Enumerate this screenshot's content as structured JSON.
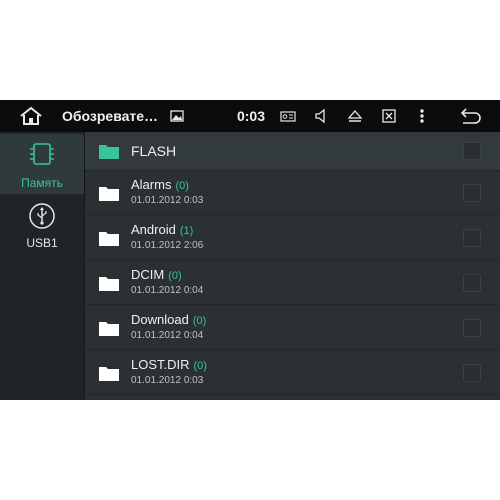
{
  "statusbar": {
    "title": "Обозревате…",
    "time": "0:03",
    "icons": [
      "home-icon",
      "gallery-icon",
      "radio-icon",
      "volume-icon",
      "eject-icon",
      "close-window-icon",
      "more-icon",
      "back-icon"
    ]
  },
  "sidebar": {
    "items": [
      {
        "label": "Память",
        "icon": "memory-chip-icon",
        "active": true
      },
      {
        "label": "USB1",
        "icon": "usb-icon",
        "active": false
      }
    ]
  },
  "list": {
    "root": {
      "name": "FLASH"
    },
    "items": [
      {
        "name": "Alarms",
        "count": "(0)",
        "date": "01.01.2012 0:03"
      },
      {
        "name": "Android",
        "count": "(1)",
        "date": "01.01.2012 2:06"
      },
      {
        "name": "DCIM",
        "count": "(0)",
        "date": "01.01.2012 0:04"
      },
      {
        "name": "Download",
        "count": "(0)",
        "date": "01.01.2012 0:04"
      },
      {
        "name": "LOST.DIR",
        "count": "(0)",
        "date": "01.01.2012 0:03"
      }
    ]
  },
  "colors": {
    "accent": "#38c59a",
    "status_bar": "#0b0c0d",
    "background": "#2b3033"
  }
}
